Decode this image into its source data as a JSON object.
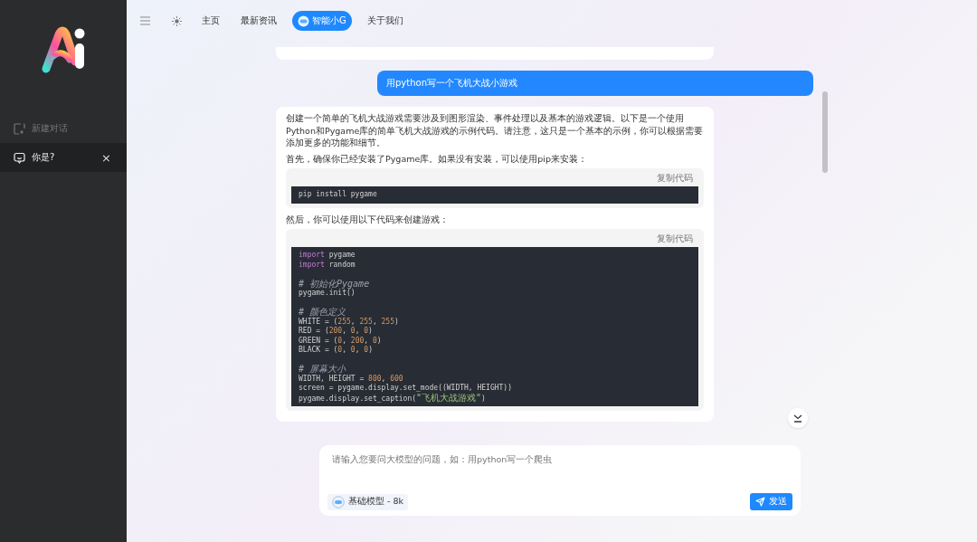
{
  "sidebar": {
    "items": [
      {
        "kind": "new",
        "label": "新建对话",
        "selected": false
      },
      {
        "kind": "chat",
        "label": "你是?",
        "selected": true,
        "close": "×"
      }
    ]
  },
  "nav": {
    "tabs": [
      {
        "label": "主页",
        "selected": false
      },
      {
        "label": "最新资讯",
        "selected": false
      },
      {
        "label": "智能小G",
        "selected": true
      },
      {
        "label": "关于我们",
        "selected": false
      }
    ]
  },
  "chat": {
    "user_message": "用python写一个飞机大战小游戏",
    "answer": {
      "paragraphs": [
        "创建一个简单的飞机大战游戏需要涉及到图形渲染、事件处理以及基本的游戏逻辑。以下是一个使用Python和Pygame库的简单飞机大战游戏的示例代码。请注意，这只是一个基本的示例，你可以根据需要添加更多的功能和细节。",
        "首先，确保你已经安装了Pygame库。如果没有安装，可以使用pip来安装："
      ],
      "code_blocks": [
        {
          "copy": "复制代码",
          "lines": [
            {
              "kind": "code",
              "segments": [
                {
                  "kind": "plain",
                  "text": "pip install pygame"
                }
              ]
            }
          ]
        },
        {
          "copy": "复制代码",
          "intro": "然后，你可以使用以下代码来创建游戏：",
          "lines": [
            {
              "kind": "code",
              "segments": [
                {
                  "kind": "keyword",
                  "text": "import"
                },
                {
                  "kind": "plain",
                  "text": " pygame"
                }
              ]
            },
            {
              "kind": "code",
              "segments": [
                {
                  "kind": "keyword",
                  "text": "import"
                },
                {
                  "kind": "plain",
                  "text": " random"
                }
              ]
            },
            {
              "kind": "blank"
            },
            {
              "kind": "code",
              "segments": [
                {
                  "kind": "comment",
                  "text": "# 初始化Pygame"
                }
              ]
            },
            {
              "kind": "code",
              "segments": [
                {
                  "kind": "plain",
                  "text": "pygame.init()"
                }
              ]
            },
            {
              "kind": "blank"
            },
            {
              "kind": "code",
              "segments": [
                {
                  "kind": "comment",
                  "text": "# 颜色定义"
                }
              ]
            },
            {
              "kind": "code",
              "segments": [
                {
                  "kind": "plain",
                  "text": "WHITE = ("
                },
                {
                  "kind": "number",
                  "text": "255"
                },
                {
                  "kind": "plain",
                  "text": ", "
                },
                {
                  "kind": "number",
                  "text": "255"
                },
                {
                  "kind": "plain",
                  "text": ", "
                },
                {
                  "kind": "number",
                  "text": "255"
                },
                {
                  "kind": "plain",
                  "text": ")"
                }
              ]
            },
            {
              "kind": "code",
              "segments": [
                {
                  "kind": "plain",
                  "text": "RED = ("
                },
                {
                  "kind": "number",
                  "text": "200"
                },
                {
                  "kind": "plain",
                  "text": ", "
                },
                {
                  "kind": "number",
                  "text": "0"
                },
                {
                  "kind": "plain",
                  "text": ", "
                },
                {
                  "kind": "number",
                  "text": "0"
                },
                {
                  "kind": "plain",
                  "text": ")"
                }
              ]
            },
            {
              "kind": "code",
              "segments": [
                {
                  "kind": "plain",
                  "text": "GREEN = ("
                },
                {
                  "kind": "number",
                  "text": "0"
                },
                {
                  "kind": "plain",
                  "text": ", "
                },
                {
                  "kind": "number",
                  "text": "200"
                },
                {
                  "kind": "plain",
                  "text": ", "
                },
                {
                  "kind": "number",
                  "text": "0"
                },
                {
                  "kind": "plain",
                  "text": ")"
                }
              ]
            },
            {
              "kind": "code",
              "segments": [
                {
                  "kind": "plain",
                  "text": "BLACK = ("
                },
                {
                  "kind": "number",
                  "text": "0"
                },
                {
                  "kind": "plain",
                  "text": ", "
                },
                {
                  "kind": "number",
                  "text": "0"
                },
                {
                  "kind": "plain",
                  "text": ", "
                },
                {
                  "kind": "number",
                  "text": "0"
                },
                {
                  "kind": "plain",
                  "text": ")"
                }
              ]
            },
            {
              "kind": "blank"
            },
            {
              "kind": "code",
              "segments": [
                {
                  "kind": "comment",
                  "text": "# 屏幕大小"
                }
              ]
            },
            {
              "kind": "code",
              "segments": [
                {
                  "kind": "plain",
                  "text": "WIDTH, HEIGHT = "
                },
                {
                  "kind": "number",
                  "text": "800"
                },
                {
                  "kind": "plain",
                  "text": ", "
                },
                {
                  "kind": "number",
                  "text": "600"
                }
              ]
            },
            {
              "kind": "code",
              "segments": [
                {
                  "kind": "plain",
                  "text": "screen = pygame.display.set_mode((WIDTH, HEIGHT))"
                }
              ]
            },
            {
              "kind": "code",
              "segments": [
                {
                  "kind": "plain",
                  "text": "pygame.display.set_caption("
                },
                {
                  "kind": "string",
                  "text": "\"飞机大战游戏\""
                },
                {
                  "kind": "plain",
                  "text": ")"
                }
              ]
            }
          ]
        }
      ]
    }
  },
  "composer": {
    "placeholder": "请输入您要问大模型的问题，如：用python写一个爬虫",
    "model": "基础模型 - 8k",
    "send": "发送"
  }
}
